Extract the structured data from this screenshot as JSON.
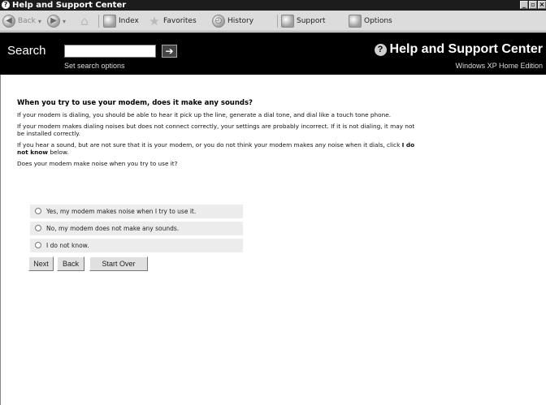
{
  "window": {
    "title": "Help and Support Center",
    "controls": {
      "minimize": "_",
      "maximize": "▫",
      "close": "×"
    }
  },
  "toolbar": {
    "back_label": "Back",
    "index_label": "Index",
    "favorites_label": "Favorites",
    "history_label": "History",
    "support_label": "Support",
    "options_label": "Options"
  },
  "header": {
    "search_label": "Search",
    "search_value": "",
    "search_options_link": "Set search options",
    "app_title": "Help and Support Center",
    "edition": "Windows XP Home Edition"
  },
  "article": {
    "heading": "When you try to use your modem, does it make any sounds?",
    "para1": "If your modem is dialing, you should be able to hear it pick up the line, generate a dial tone, and dial like a touch tone phone.",
    "para2_line1": "If your modem makes dialing noises but does not connect correctly, your settings are probably incorrect. If it is not dialing, it may not",
    "para2_line2": "be installed correctly.",
    "para3_line1": "If you hear a sound, but are not sure that it is your modem, or you do not think your modem makes any noise when it dials, click",
    "para3_bold1": "I do",
    "para3_bold2": "not know",
    "para3_end": "below.",
    "question": "Does your modem make noise when you try to use it?",
    "options": [
      "Yes, my modem makes noise when I try to use it.",
      "No, my modem does not make any sounds.",
      "I do not know."
    ],
    "buttons": {
      "next": "Next",
      "back": "Back",
      "start_over": "Start Over"
    }
  }
}
